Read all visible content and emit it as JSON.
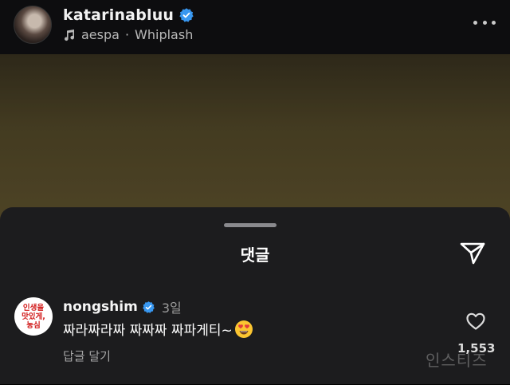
{
  "header": {
    "username": "katarinabluu",
    "music_artist": "aespa",
    "music_separator": "·",
    "music_title": "Whiplash",
    "icons": [
      "verified-badge-icon",
      "music-note-icon",
      "more-options-icon"
    ]
  },
  "sheet": {
    "title": "댓글",
    "icons": [
      "send-icon"
    ]
  },
  "comment": {
    "avatar_text_lines": [
      "인생을",
      "맛있게,",
      "농심"
    ],
    "username": "nongshim",
    "time": "3일",
    "text": "짜라짜라짜 짜짜짜 짜파게티~",
    "emoji": "heart-eyes-emoji",
    "reply_label": "답글 달기",
    "like_count": "1,553",
    "icons": [
      "verified-badge-icon",
      "heart-icon"
    ]
  },
  "watermark": "인스티즈",
  "colors": {
    "verified_blue": "#3897f0",
    "sheet_bg": "#1c1c1e",
    "brand_red": "#d11a1a"
  }
}
